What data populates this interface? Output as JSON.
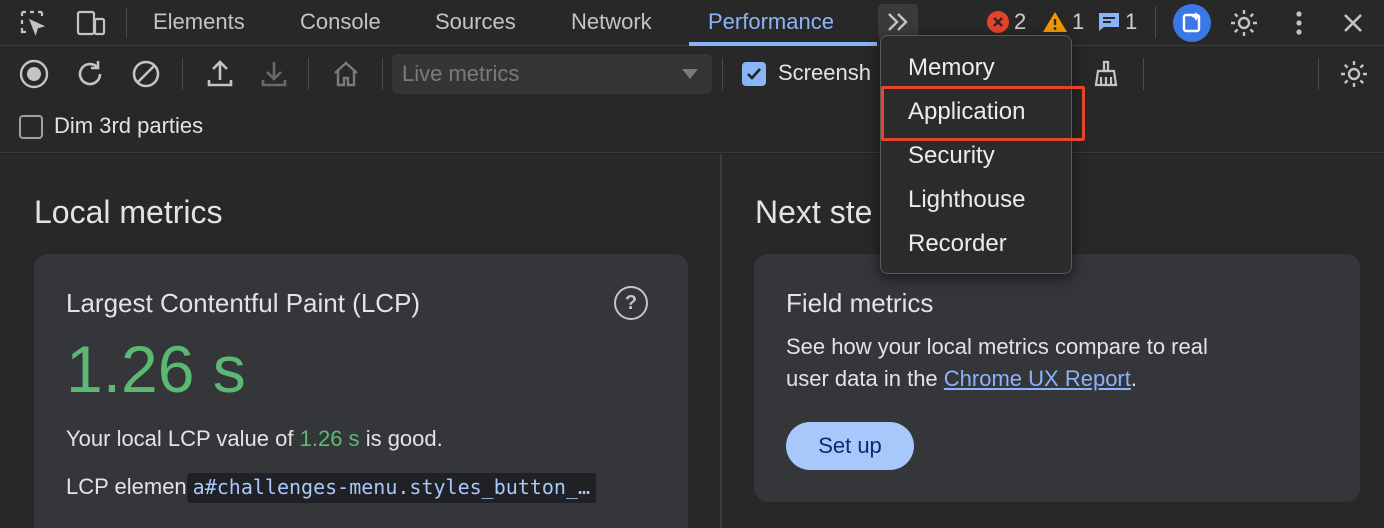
{
  "tabs": {
    "items": [
      {
        "label": "Elements"
      },
      {
        "label": "Console"
      },
      {
        "label": "Sources"
      },
      {
        "label": "Network"
      },
      {
        "label": "Performance"
      }
    ],
    "active": "Performance"
  },
  "status": {
    "errors": "2",
    "warnings": "1",
    "messages": "1"
  },
  "toolbar": {
    "metrics_select": "Live metrics",
    "screenshots_label": "Screensh",
    "dim_label": "Dim 3rd parties"
  },
  "overflow_menu": {
    "items": [
      "Memory",
      "Application",
      "Security",
      "Lighthouse",
      "Recorder"
    ],
    "highlighted": "Application"
  },
  "local_metrics": {
    "heading": "Local metrics",
    "lcp_card": {
      "title": "Largest Contentful Paint (LCP)",
      "value": "1.26 s",
      "desc_prefix": "Your local LCP value of",
      "desc_value": "1.26 s",
      "desc_suffix": "is good.",
      "element_label": "LCP elemen",
      "element_code": "a#challenges-menu.styles_button_…"
    }
  },
  "next_steps": {
    "heading": "Next ste",
    "field_card": {
      "title": "Field metrics",
      "line1": "See how your local metrics compare to real",
      "line2_prefix": "user data in the",
      "link": "Chrome UX Report",
      "line2_suffix": ".",
      "button": "Set up"
    }
  },
  "colors": {
    "accent": "#8ab4f8",
    "good": "#5bb974",
    "error": "#e5432d",
    "warning": "#f29900"
  }
}
